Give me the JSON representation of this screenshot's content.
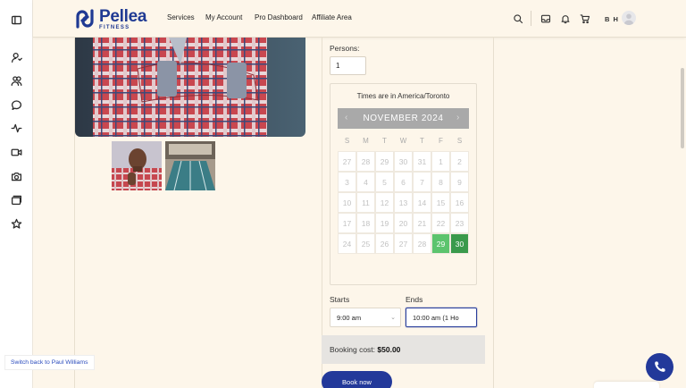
{
  "header": {
    "logo_name": "Pellea",
    "logo_sub": "FITNESS",
    "nav": [
      {
        "label": "Services"
      },
      {
        "label": "My Account"
      },
      {
        "label": "Pro Dashboard"
      },
      {
        "label": "Affiliate Area"
      }
    ],
    "icons": [
      "search-icon",
      "inbox-icon",
      "bell-icon",
      "cart-icon"
    ],
    "user_initials": "B H"
  },
  "sidebar": {
    "icons": [
      "sidebar-toggle-icon",
      "user-icon",
      "users-icon",
      "chat-icon",
      "activity-icon",
      "video-icon",
      "camera-icon",
      "cards-icon",
      "star-icon"
    ]
  },
  "booking": {
    "persons_label": "Persons:",
    "persons_value": "1",
    "timezone_note": "Times are in America/Toronto",
    "calendar": {
      "month_label": "NOVEMBER 2024",
      "prev": "‹",
      "next": "›",
      "weekdays": [
        "S",
        "M",
        "T",
        "W",
        "T",
        "F",
        "S"
      ],
      "weeks": [
        [
          "27",
          "28",
          "29",
          "30",
          "31",
          "1",
          "2"
        ],
        [
          "3",
          "4",
          "5",
          "6",
          "7",
          "8",
          "9"
        ],
        [
          "10",
          "11",
          "12",
          "13",
          "14",
          "15",
          "16"
        ],
        [
          "17",
          "18",
          "19",
          "20",
          "21",
          "22",
          "23"
        ],
        [
          "24",
          "25",
          "26",
          "27",
          "28",
          "29",
          "30"
        ]
      ],
      "selected_days": [
        "29",
        "30"
      ]
    },
    "starts_label": "Starts",
    "starts_value": "9:00 am",
    "ends_label": "Ends",
    "ends_value": "10:00 am (1 Ho",
    "cost_label": "Booking cost:",
    "cost_value": "$50.00",
    "book_button": "Book now"
  },
  "footer": {
    "switch_back": "Switch back to Paul Williams"
  },
  "colors": {
    "brand": "#23399a",
    "selected_light": "#5cc46e",
    "selected_dark": "#3a9a4c",
    "page_bg": "#fdf6ea"
  }
}
